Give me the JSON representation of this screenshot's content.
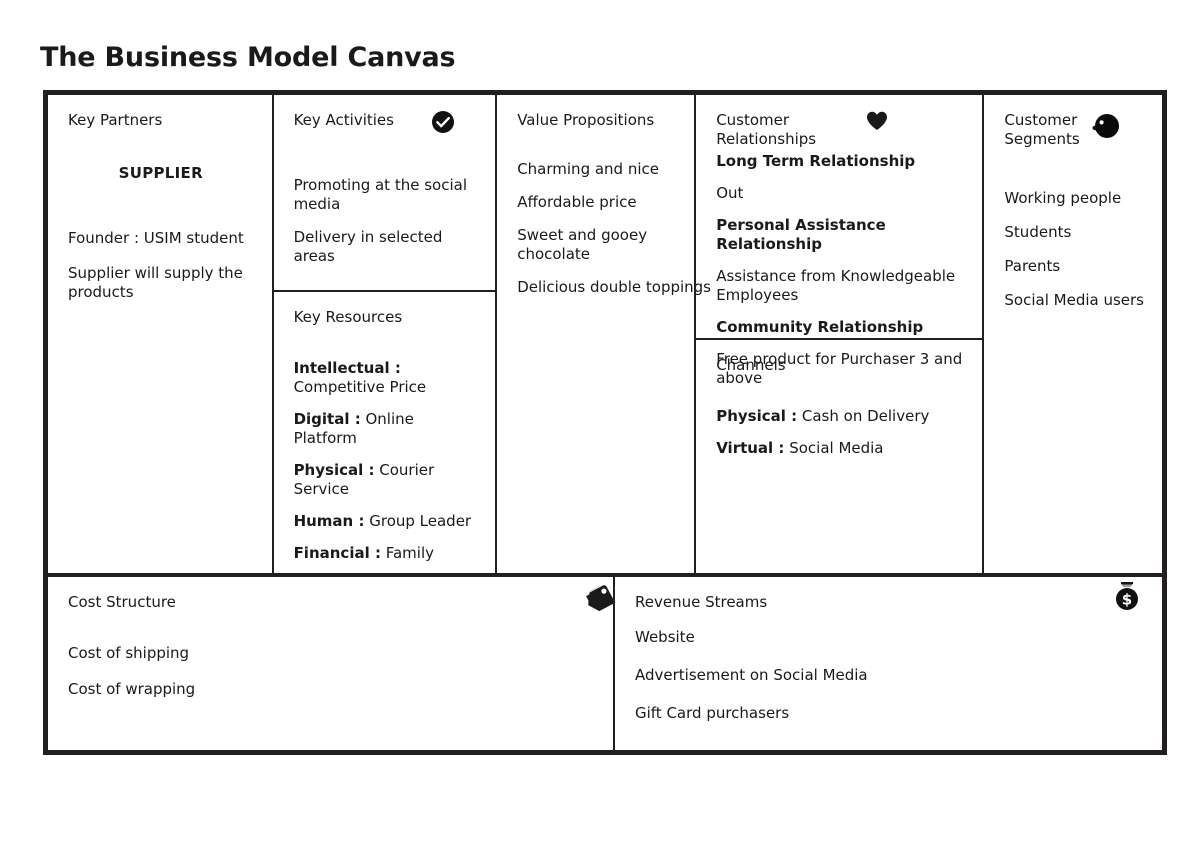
{
  "title": "The Business Model Canvas",
  "blocks": {
    "key_partners": {
      "title": "Key Partners",
      "icon": "none",
      "entries": [
        "SUPPLIER",
        "Founder : USIM student",
        "Supplier will supply the products"
      ]
    },
    "key_activities": {
      "title": "Key Activities",
      "icon": "check-circle-icon",
      "entries": [
        "Promoting at the social media",
        "Delivery in selected areas"
      ]
    },
    "key_resources": {
      "title": "Key Resources",
      "icon": "none",
      "entries": [
        {
          "label": "Intellectual :",
          "value": "Competitive Price"
        },
        {
          "label": "Digital :",
          "value": "Online Platform"
        },
        {
          "label": "Physical :",
          "value": "Courier Service"
        },
        {
          "label": "Human :",
          "value": "Group Leader"
        },
        {
          "label": "Financial :",
          "value": "Family"
        }
      ]
    },
    "value_propositions": {
      "title": "Value Propositions",
      "icon": "none",
      "entries": [
        "Charming and nice",
        "Affordable price",
        "Sweet and gooey chocolate",
        "Delicious double toppings"
      ]
    },
    "customer_relationships": {
      "title": "Customer Relationships",
      "icon": "heart-icon",
      "entries": [
        {
          "heading": "Long Term Relationship",
          "detail": "Out"
        },
        {
          "heading": "Personal Assistance Relationship",
          "detail": "Assistance from Knowledgeable Employees"
        },
        {
          "heading": "Community Relationship",
          "detail": "Free product for Purchaser 3 and above"
        }
      ]
    },
    "channels": {
      "title": "Channels",
      "icon": "none",
      "entries": [
        {
          "label": "Physical :",
          "value": "Cash on Delivery"
        },
        {
          "label": "Virtual :",
          "value": "Social Media"
        }
      ]
    },
    "customer_segments": {
      "title": "Customer Segments",
      "icon": "person-head-icon",
      "entries": [
        "Working people",
        "Students",
        "Parents",
        "Social Media users"
      ]
    },
    "cost_structure": {
      "title": "Cost Structure",
      "icon": "price-tag-icon",
      "entries": [
        "Cost of shipping",
        "Cost of wrapping"
      ]
    },
    "revenue_streams": {
      "title": "Revenue Streams",
      "icon": "money-bag-icon",
      "entries": [
        "Website",
        "Advertisement on Social Media",
        "Gift Card purchasers"
      ]
    }
  },
  "colors": {
    "frame": "#231f20",
    "text": "#1a1a1a",
    "background": "#ffffff"
  }
}
